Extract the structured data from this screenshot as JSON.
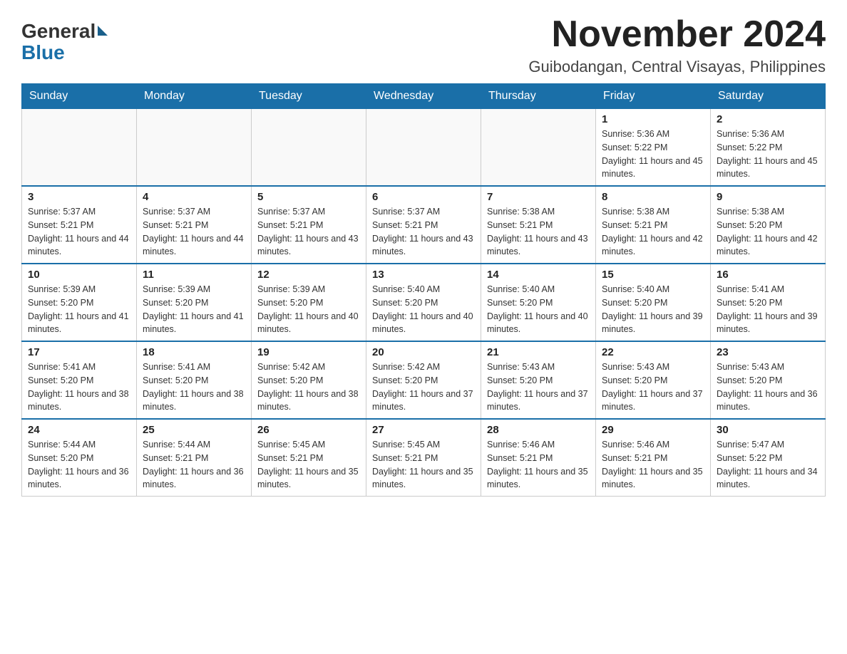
{
  "logo": {
    "general": "General",
    "blue": "Blue"
  },
  "title": {
    "month_year": "November 2024",
    "location": "Guibodangan, Central Visayas, Philippines"
  },
  "days_of_week": [
    "Sunday",
    "Monday",
    "Tuesday",
    "Wednesday",
    "Thursday",
    "Friday",
    "Saturday"
  ],
  "weeks": [
    [
      {
        "day": "",
        "info": ""
      },
      {
        "day": "",
        "info": ""
      },
      {
        "day": "",
        "info": ""
      },
      {
        "day": "",
        "info": ""
      },
      {
        "day": "",
        "info": ""
      },
      {
        "day": "1",
        "info": "Sunrise: 5:36 AM\nSunset: 5:22 PM\nDaylight: 11 hours and 45 minutes."
      },
      {
        "day": "2",
        "info": "Sunrise: 5:36 AM\nSunset: 5:22 PM\nDaylight: 11 hours and 45 minutes."
      }
    ],
    [
      {
        "day": "3",
        "info": "Sunrise: 5:37 AM\nSunset: 5:21 PM\nDaylight: 11 hours and 44 minutes."
      },
      {
        "day": "4",
        "info": "Sunrise: 5:37 AM\nSunset: 5:21 PM\nDaylight: 11 hours and 44 minutes."
      },
      {
        "day": "5",
        "info": "Sunrise: 5:37 AM\nSunset: 5:21 PM\nDaylight: 11 hours and 43 minutes."
      },
      {
        "day": "6",
        "info": "Sunrise: 5:37 AM\nSunset: 5:21 PM\nDaylight: 11 hours and 43 minutes."
      },
      {
        "day": "7",
        "info": "Sunrise: 5:38 AM\nSunset: 5:21 PM\nDaylight: 11 hours and 43 minutes."
      },
      {
        "day": "8",
        "info": "Sunrise: 5:38 AM\nSunset: 5:21 PM\nDaylight: 11 hours and 42 minutes."
      },
      {
        "day": "9",
        "info": "Sunrise: 5:38 AM\nSunset: 5:20 PM\nDaylight: 11 hours and 42 minutes."
      }
    ],
    [
      {
        "day": "10",
        "info": "Sunrise: 5:39 AM\nSunset: 5:20 PM\nDaylight: 11 hours and 41 minutes."
      },
      {
        "day": "11",
        "info": "Sunrise: 5:39 AM\nSunset: 5:20 PM\nDaylight: 11 hours and 41 minutes."
      },
      {
        "day": "12",
        "info": "Sunrise: 5:39 AM\nSunset: 5:20 PM\nDaylight: 11 hours and 40 minutes."
      },
      {
        "day": "13",
        "info": "Sunrise: 5:40 AM\nSunset: 5:20 PM\nDaylight: 11 hours and 40 minutes."
      },
      {
        "day": "14",
        "info": "Sunrise: 5:40 AM\nSunset: 5:20 PM\nDaylight: 11 hours and 40 minutes."
      },
      {
        "day": "15",
        "info": "Sunrise: 5:40 AM\nSunset: 5:20 PM\nDaylight: 11 hours and 39 minutes."
      },
      {
        "day": "16",
        "info": "Sunrise: 5:41 AM\nSunset: 5:20 PM\nDaylight: 11 hours and 39 minutes."
      }
    ],
    [
      {
        "day": "17",
        "info": "Sunrise: 5:41 AM\nSunset: 5:20 PM\nDaylight: 11 hours and 38 minutes."
      },
      {
        "day": "18",
        "info": "Sunrise: 5:41 AM\nSunset: 5:20 PM\nDaylight: 11 hours and 38 minutes."
      },
      {
        "day": "19",
        "info": "Sunrise: 5:42 AM\nSunset: 5:20 PM\nDaylight: 11 hours and 38 minutes."
      },
      {
        "day": "20",
        "info": "Sunrise: 5:42 AM\nSunset: 5:20 PM\nDaylight: 11 hours and 37 minutes."
      },
      {
        "day": "21",
        "info": "Sunrise: 5:43 AM\nSunset: 5:20 PM\nDaylight: 11 hours and 37 minutes."
      },
      {
        "day": "22",
        "info": "Sunrise: 5:43 AM\nSunset: 5:20 PM\nDaylight: 11 hours and 37 minutes."
      },
      {
        "day": "23",
        "info": "Sunrise: 5:43 AM\nSunset: 5:20 PM\nDaylight: 11 hours and 36 minutes."
      }
    ],
    [
      {
        "day": "24",
        "info": "Sunrise: 5:44 AM\nSunset: 5:20 PM\nDaylight: 11 hours and 36 minutes."
      },
      {
        "day": "25",
        "info": "Sunrise: 5:44 AM\nSunset: 5:21 PM\nDaylight: 11 hours and 36 minutes."
      },
      {
        "day": "26",
        "info": "Sunrise: 5:45 AM\nSunset: 5:21 PM\nDaylight: 11 hours and 35 minutes."
      },
      {
        "day": "27",
        "info": "Sunrise: 5:45 AM\nSunset: 5:21 PM\nDaylight: 11 hours and 35 minutes."
      },
      {
        "day": "28",
        "info": "Sunrise: 5:46 AM\nSunset: 5:21 PM\nDaylight: 11 hours and 35 minutes."
      },
      {
        "day": "29",
        "info": "Sunrise: 5:46 AM\nSunset: 5:21 PM\nDaylight: 11 hours and 35 minutes."
      },
      {
        "day": "30",
        "info": "Sunrise: 5:47 AM\nSunset: 5:22 PM\nDaylight: 11 hours and 34 minutes."
      }
    ]
  ]
}
